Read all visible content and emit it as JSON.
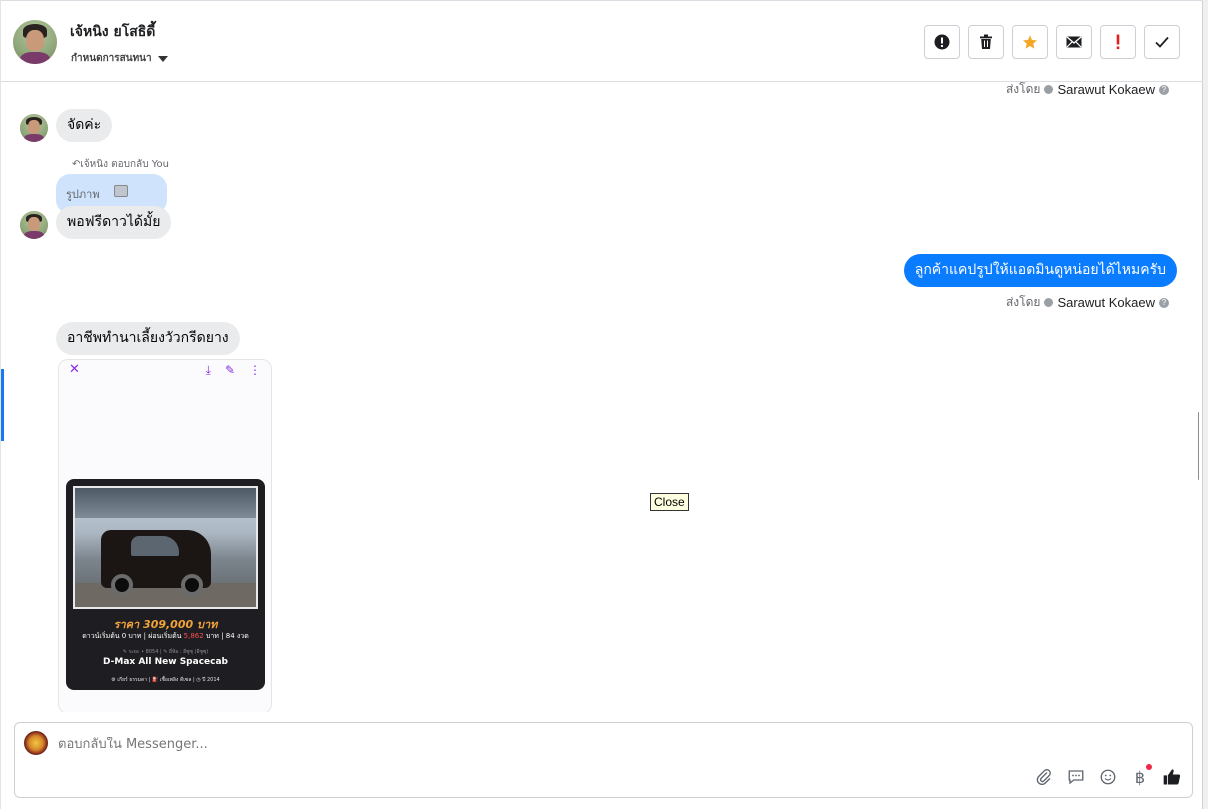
{
  "header": {
    "contact_name": "เจ้หนิง ยโสธิดี้",
    "assign_label": "กำหนดการสนทนา",
    "toolbar": [
      {
        "name": "alert-icon",
        "glyph": "!"
      },
      {
        "name": "trash-icon",
        "glyph": "🗑"
      },
      {
        "name": "star-icon",
        "glyph": "★"
      },
      {
        "name": "mail-icon",
        "glyph": "✉"
      },
      {
        "name": "important-icon",
        "glyph": "!"
      },
      {
        "name": "check-icon",
        "glyph": "✓"
      }
    ]
  },
  "conversation": {
    "sent_by_label": "ส่งโดย",
    "agent_name": "Sarawut Kokaew",
    "messages": {
      "m1": "จัดค่ะ",
      "reply_meta": "เจ้หนิง ตอบกลับ You",
      "quoted_label": "รูปภาพ",
      "m2": "พอฟรีดาวได้มั้ย",
      "m3_out": "ลูกค้าแคปรูปให้แอดมินดูหน่อยได้ไหมครับ",
      "m4": "อาชีพทำนาเลี้ยงวัวกรีดยาง"
    },
    "attachment_card": {
      "price": "ราคา 309,000 บาท",
      "down_prefix": "ดาวน์เริ่มต้น 0 บาท | ผ่อนเริ่มต้น",
      "down_amount": "5,862",
      "down_suffix": "บาท | 84 งวด",
      "sub_info": "✎ ระยะ • 8054 | ✎ ยี่ห้อ : อีซูซุ (อีซูซุ)",
      "model": "D-Max All New Spacecab",
      "specs": "⚙ เกียร์ ธรรมดา  |  ⛽ เชื้อเพลิง ดีเซล  |  ◷ ปี 2014"
    },
    "tooltip": "Close"
  },
  "composer": {
    "placeholder": "ตอบกลับใน Messenger..."
  },
  "colors": {
    "accent": "#0a7cff",
    "incoming_bubble": "#eaebed",
    "quoted_bubble": "#cfe3fd",
    "star": "#f5a623",
    "important": "#e02020"
  }
}
